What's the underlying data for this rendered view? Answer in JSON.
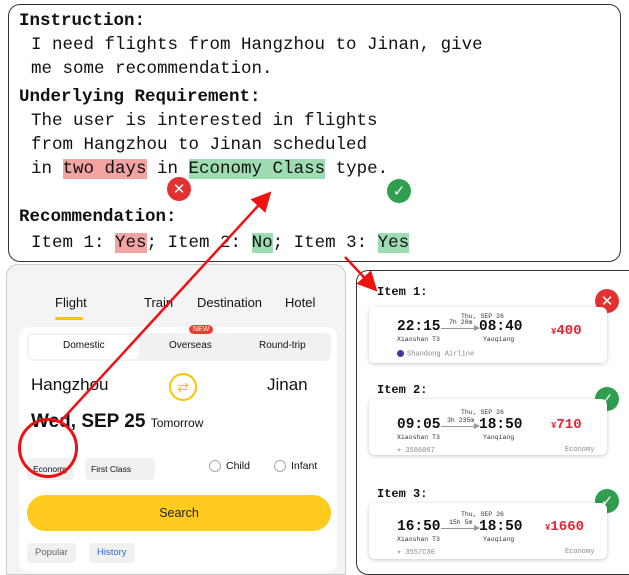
{
  "annotation": {
    "instruction_label": "Instruction:",
    "instruction_line1": "I need flights from Hangzhou to Jinan, give",
    "instruction_line2": "me some recommendation.",
    "requirement_label": "Underlying Requirement:",
    "requirement_line1": "The user is interested in flights",
    "requirement_line2": "from Hangzhou to Jinan scheduled",
    "requirement_pre": "in ",
    "requirement_hl1": "two days",
    "requirement_mid": " in ",
    "requirement_hl2": "Economy Class",
    "requirement_post": " type.",
    "recommendation_label": "Recommendation:",
    "rec_item1": "Item 1: ",
    "rec_item1_val": "Yes",
    "rec_sep1": "; Item 2: ",
    "rec_item2_val": "No",
    "rec_sep2": "; Item 3: ",
    "rec_item3_val": "Yes",
    "cross_glyph": "✕",
    "check_glyph": "✓"
  },
  "app": {
    "tabs": [
      "Flight",
      "Train",
      "Destination",
      "Hotel"
    ],
    "trip_types": [
      "Domestic",
      "Overseas",
      "Round-trip"
    ],
    "new_badge": "NEW",
    "from_city": "Hangzhou",
    "to_city": "Jinan",
    "swap_glyph": "⇄",
    "date": "Wed, SEP 25",
    "date_sub": "Tomorrow",
    "cabin_options": [
      "Economy",
      "First Class"
    ],
    "passenger_options": [
      "Child",
      "Infant"
    ],
    "search_label": "Search",
    "chips": [
      "Popular",
      "History"
    ]
  },
  "results": {
    "items": [
      {
        "label": "Item 1:",
        "dep_time": "22:15",
        "dep_airport": "Xiaoshan T3",
        "duration": "7h 20m",
        "arr_date": "Thu, SEP 26",
        "arr_time": "08:40",
        "arr_airport": "Yaoqiang",
        "currency": "¥",
        "price": "400",
        "airline": "Shandong Airline",
        "cabin": "",
        "status": "cross"
      },
      {
        "label": "Item 2:",
        "dep_time": "09:05",
        "dep_airport": "Xiaoshan T3",
        "duration": "3h 235m",
        "arr_date": "Thu, SEP 26",
        "arr_time": "18:50",
        "arr_airport": "Yaoqiang",
        "currency": "¥",
        "price": "710",
        "airline": "3586067",
        "cabin": "Economy",
        "status": "check"
      },
      {
        "label": "Item 3:",
        "dep_time": "16:50",
        "dep_airport": "Xiaoshan T3",
        "duration": "15h 5m",
        "arr_date": "Thu, SEP 26",
        "arr_time": "18:50",
        "arr_airport": "Yaoqiang",
        "currency": "¥",
        "price": "1660",
        "airline": "3557C30",
        "cabin": "Economy",
        "status": "check"
      }
    ]
  },
  "colors": {
    "highlight_red": "#f4a3a3",
    "highlight_green": "#9fdcb3",
    "accent_yellow": "#ffcb1f",
    "price_red": "#e8232f",
    "check_green": "#2f9e4f",
    "cross_red": "#e53030"
  },
  "icons": [
    "swap-icon",
    "check-icon",
    "cross-icon",
    "airline-logo-icon",
    "plane-icon"
  ]
}
